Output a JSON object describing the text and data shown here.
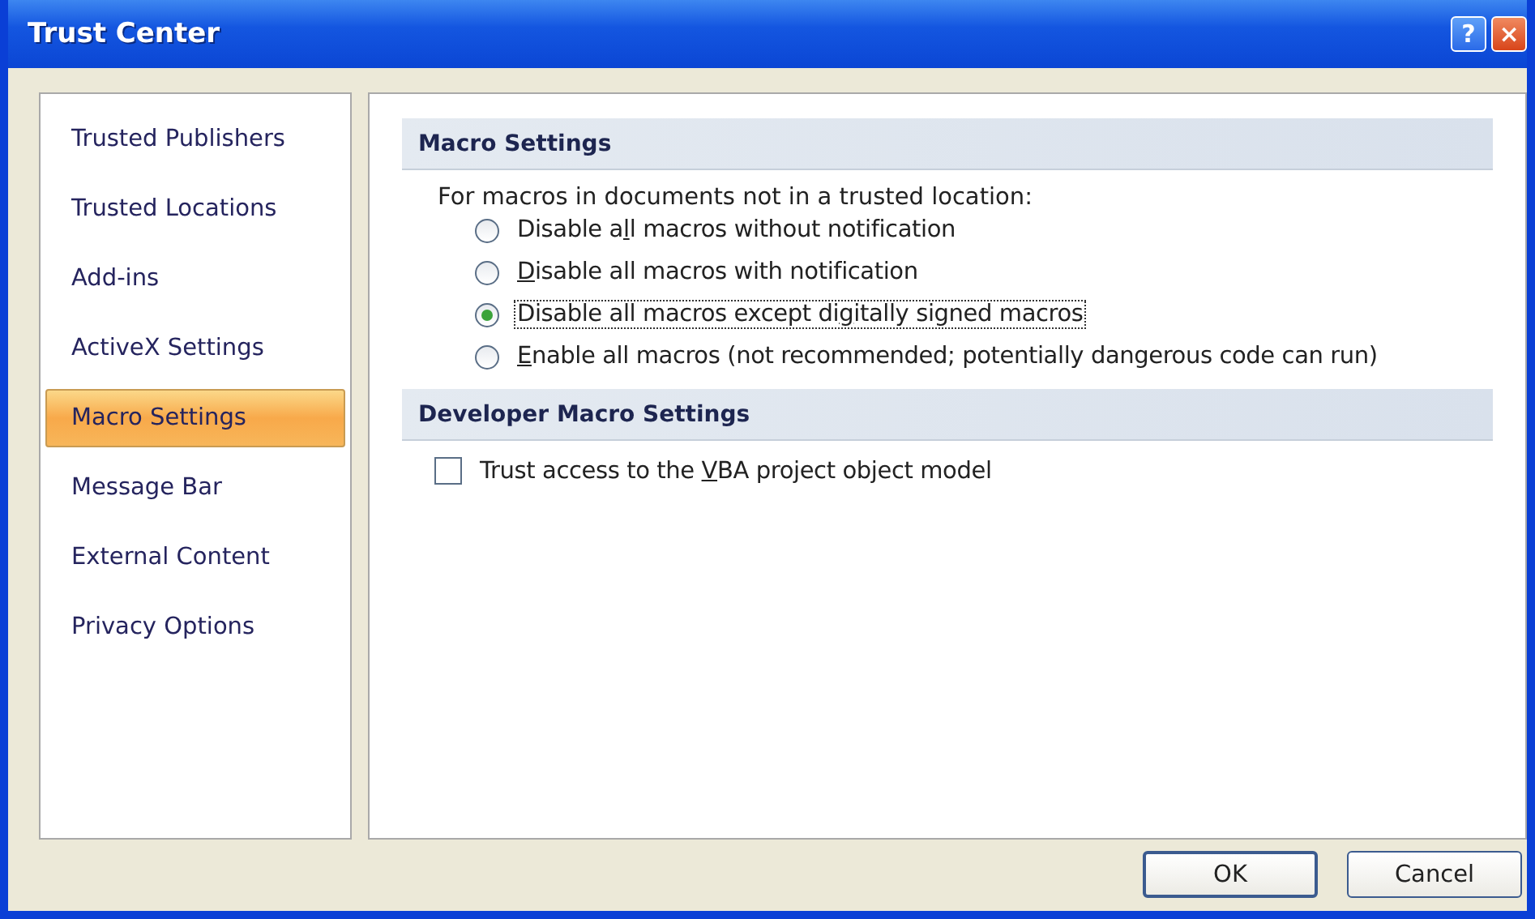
{
  "window": {
    "title": "Trust Center",
    "help": "?",
    "close": "×"
  },
  "sidebar": {
    "items": [
      {
        "label": "Trusted Publishers",
        "selected": false
      },
      {
        "label": "Trusted Locations",
        "selected": false
      },
      {
        "label": "Add-ins",
        "selected": false
      },
      {
        "label": "ActiveX Settings",
        "selected": false
      },
      {
        "label": "Macro Settings",
        "selected": true
      },
      {
        "label": "Message Bar",
        "selected": false
      },
      {
        "label": "External Content",
        "selected": false
      },
      {
        "label": "Privacy Options",
        "selected": false
      }
    ]
  },
  "sections": [
    {
      "title": "Macro Settings",
      "intro": "For macros in documents not in a trusted location:",
      "options": [
        {
          "kind": "radio",
          "pre": "Disable a",
          "key": "l",
          "post": "l macros without notification",
          "selected": false,
          "focused": false
        },
        {
          "kind": "radio",
          "key": "D",
          "post": "isable all macros with notification",
          "selected": false,
          "focused": false
        },
        {
          "kind": "radio",
          "pre": "Disable all macros except di",
          "key": "g",
          "post": "itally signed macros",
          "selected": true,
          "focused": true
        },
        {
          "kind": "radio",
          "key": "E",
          "post": "nable all macros (not recommended; potentially dangerous code can run)",
          "selected": false,
          "focused": false
        }
      ]
    },
    {
      "title": "Developer Macro Settings",
      "options": [
        {
          "kind": "checkbox",
          "pre": "Trust access to the ",
          "key": "V",
          "post": "BA project object model",
          "checked": false,
          "focused": false
        }
      ]
    }
  ],
  "buttons": [
    {
      "label": "OK",
      "default": true
    },
    {
      "label": "Cancel",
      "default": false
    }
  ]
}
